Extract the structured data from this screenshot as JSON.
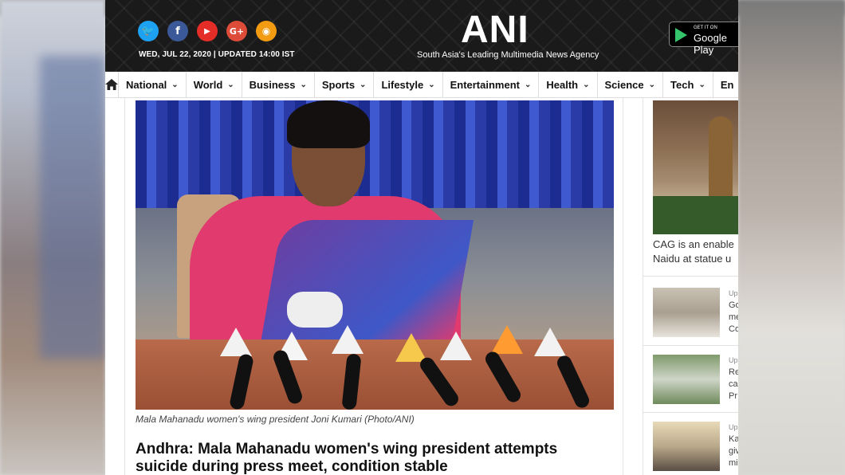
{
  "header": {
    "date_line": "WED, JUL 22, 2020  | UPDATED 14:00 IST",
    "logo": "ANI",
    "tagline": "South Asia's Leading Multimedia News Agency",
    "store_badge": {
      "small": "GET IT ON",
      "big": "Google Play"
    },
    "social": [
      {
        "icon": "twitter-icon",
        "glyph": "t",
        "color": "#1da1f2"
      },
      {
        "icon": "facebook-icon",
        "glyph": "f",
        "color": "#3b5998"
      },
      {
        "icon": "youtube-icon",
        "glyph": "▶",
        "color": "#e52d27"
      },
      {
        "icon": "google-plus-icon",
        "glyph": "G+",
        "color": "#dd4b39"
      },
      {
        "icon": "rss-icon",
        "glyph": "◉",
        "color": "#f39c12"
      }
    ]
  },
  "nav": {
    "items": [
      "National",
      "World",
      "Business",
      "Sports",
      "Lifestyle",
      "Entertainment",
      "Health",
      "Science",
      "Tech",
      "En"
    ]
  },
  "article": {
    "caption": "Mala Mahanadu women's wing president Joni Kumari (Photo/ANI)",
    "headline_line1": "Andhra: Mala Mahanadu women's wing president attempts",
    "headline_line2": "suicide during press meet, condition stable"
  },
  "sidebar": {
    "feature_caption_line1": "CAG is an enable",
    "feature_caption_line2": "Naidu at statue u",
    "items": [
      {
        "label_up": "Up",
        "l1": "Go",
        "l2": "me",
        "l3": "Co"
      },
      {
        "label_up": "Up",
        "l1": "Re",
        "l2": "ca",
        "l3": "Pr"
      },
      {
        "label_up": "Up",
        "l1": "Ka",
        "l2": "giv",
        "l3": "mi"
      }
    ]
  },
  "colors": {
    "header_bg": "#1a1a1a",
    "accent": "#ffffff"
  }
}
